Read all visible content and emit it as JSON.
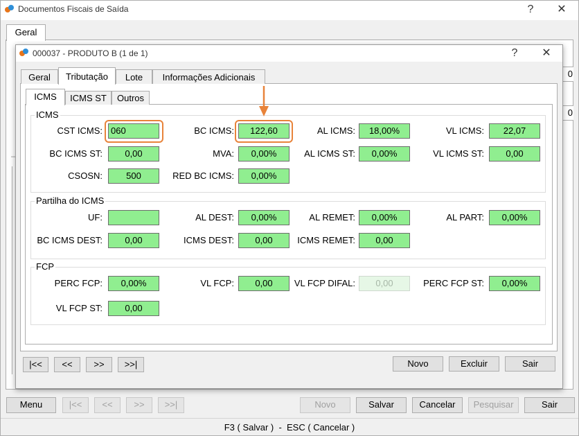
{
  "main_window": {
    "title": "Documentos Fiscais de Saída",
    "help": "?",
    "close": "✕",
    "tab": "Geral",
    "partial_right_texts": [
      "0",
      "0"
    ],
    "partial_left_marker": "–"
  },
  "dialog": {
    "title": "000037 - PRODUTO B (1 de 1)",
    "help": "?",
    "close": "✕",
    "tabs": [
      "Geral",
      "Tributação",
      "Lote",
      "Informações Adicionais"
    ],
    "subtabs": [
      "ICMS",
      "ICMS ST",
      "Outros"
    ],
    "groups": {
      "icms": {
        "title": "ICMS",
        "cst_icms": {
          "label": "CST ICMS:",
          "value": "060"
        },
        "bc_icms": {
          "label": "BC ICMS:",
          "value": "122,60"
        },
        "al_icms": {
          "label": "AL ICMS:",
          "value": "18,00%"
        },
        "vl_icms": {
          "label": "VL ICMS:",
          "value": "22,07"
        },
        "bc_icms_st": {
          "label": "BC ICMS ST:",
          "value": "0,00"
        },
        "mva": {
          "label": "MVA:",
          "value": "0,00%"
        },
        "al_icms_st": {
          "label": "AL ICMS ST:",
          "value": "0,00%"
        },
        "vl_icms_st": {
          "label": "VL ICMS ST:",
          "value": "0,00"
        },
        "csosn": {
          "label": "CSOSN:",
          "value": "500"
        },
        "red_bc_icms": {
          "label": "RED BC ICMS:",
          "value": "0,00%"
        }
      },
      "partilha": {
        "title": "Partilha do ICMS",
        "uf": {
          "label": "UF:",
          "value": ""
        },
        "al_dest": {
          "label": "AL DEST:",
          "value": "0,00%"
        },
        "al_remet": {
          "label": "AL REMET:",
          "value": "0,00%"
        },
        "al_part": {
          "label": "AL PART:",
          "value": "0,00%"
        },
        "bc_icms_dest": {
          "label": "BC ICMS DEST:",
          "value": "0,00"
        },
        "icms_dest": {
          "label": "ICMS DEST:",
          "value": "0,00"
        },
        "icms_remet": {
          "label": "ICMS REMET:",
          "value": "0,00"
        }
      },
      "fcp": {
        "title": "FCP",
        "perc_fcp": {
          "label": "PERC FCP:",
          "value": "0,00%"
        },
        "vl_fcp": {
          "label": "VL FCP:",
          "value": "0,00"
        },
        "vl_fcp_difal": {
          "label": "VL FCP DIFAL:",
          "value": "0,00"
        },
        "perc_fcp_st": {
          "label": "PERC FCP ST:",
          "value": "0,00%"
        },
        "vl_fcp_st": {
          "label": "VL FCP ST:",
          "value": "0,00"
        }
      }
    },
    "nav": {
      "first": "|<<",
      "prev": "<<",
      "next": ">>",
      "last": ">>|"
    },
    "actions": {
      "novo": "Novo",
      "excluir": "Excluir",
      "sair": "Sair"
    }
  },
  "bottom_bar": {
    "menu": "Menu",
    "first": "|<<",
    "prev": "<<",
    "next": ">>",
    "last": ">>|",
    "novo": "Novo",
    "salvar": "Salvar",
    "cancelar": "Cancelar",
    "pesquisar": "Pesquisar",
    "sair": "Sair"
  },
  "status_bar": "F3 ( Salvar )  -  ESC ( Cancelar )",
  "annotation_color": "#e8833a",
  "field_color": "#90ee90"
}
